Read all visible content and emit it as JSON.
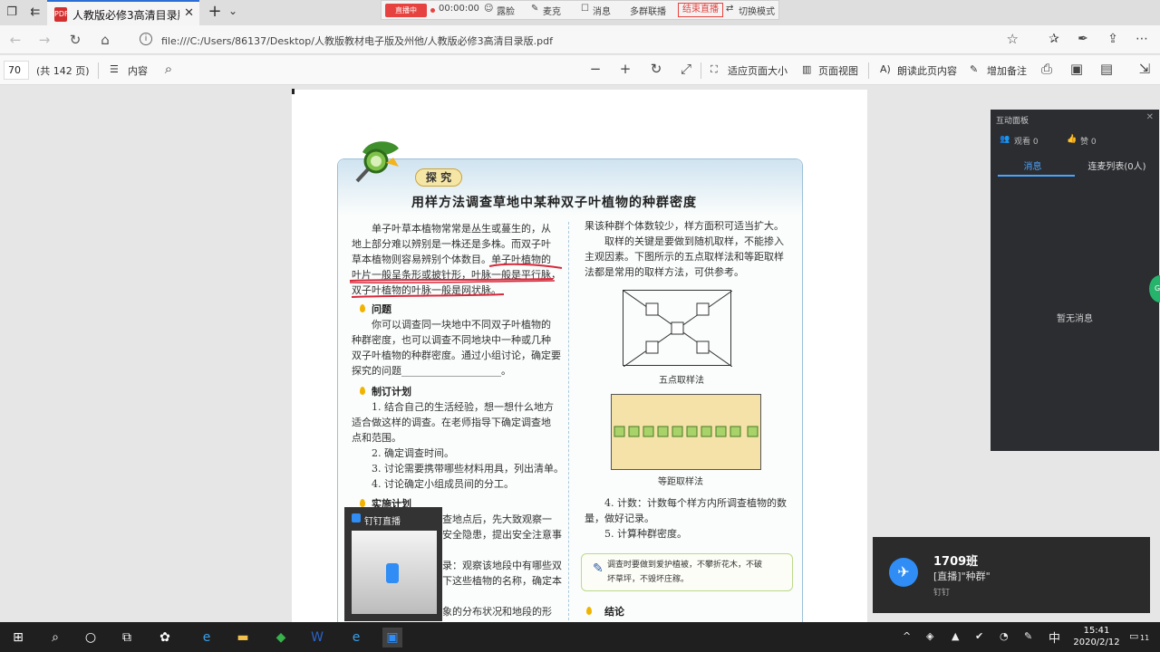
{
  "browser": {
    "tab_title": "人教版必修3高清目录版",
    "url": "file:///C:/Users/86137/Desktop/人教版教材电子版及州他/人教版必修3高清目录版.pdf"
  },
  "live_toolbar": {
    "status": "直播中",
    "timer": "00:00:00",
    "item_hide": "露脸",
    "item_mic": "麦克",
    "item_message": "消息",
    "item_multi": "多群联播",
    "item_end": "结束直播",
    "item_switch": "切换模式"
  },
  "pdf_toolbar": {
    "page_number": "70",
    "page_total": "(共 142 页)",
    "contents": "内容",
    "fit_page": "适应页面大小",
    "page_view": "页面视图",
    "read_aloud": "朗读此页内容",
    "add_notes": "增加备注"
  },
  "page": {
    "tag": "探 究",
    "heading": "用样方法调查草地中某种双子叶植物的种群密度",
    "left_lines": [
      "单子叶草本植物常常是丛生或蔓生的，从",
      "地上部分难以辨别是一株还是多株。而双子叶",
      "草本植物则容易辨别个体数目。单子叶植物的",
      "叶片一般呈条形或披针形，叶脉一般是平行脉，",
      "双子叶植物的叶脉一般是网状脉。"
    ],
    "sec_problem": "问题",
    "problem_lines": [
      "你可以调查同一块地中不同双子叶植物的",
      "种群密度，也可以调查不同地块中一种或几种",
      "双子叶植物的种群密度。通过小组讨论，确定要",
      "探究的问题____________________。"
    ],
    "sec_plan": "制订计划",
    "plan_lines": [
      "1. 结合自己的生活经验，想一想什么地方",
      "适合做这样的调查。在老师指导下确定调查地",
      "点和范围。",
      "2. 确定调查时间。",
      "3. 讨论需要携带哪些材料用具，列出清单。",
      "4. 讨论确定小组成员间的分工。"
    ],
    "sec_implement": "实施计划",
    "implement_lines": [
      "查地点后，先大致观察一",
      "安全隐患，提出安全注意事",
      "",
      "录：观察该地段中有哪些双",
      "下这些植物的名称，确定本",
      "",
      "象的分布状况和地段的形"
    ],
    "right_lines": [
      "果该种群个体数较少，样方面积可适当扩大。",
      "取样的关键是要做到随机取样，不能掺入",
      "主观因素。下图所示的五点取样法和等距取样",
      "法都是常用的取样方法，可供参考。"
    ],
    "fig1_caption": "五点取样法",
    "fig2_caption": "等距取样法",
    "count_lines": [
      "4. 计数：计数每个样方内所调查植物的数",
      "量，做好记录。",
      "5. 计算种群密度。"
    ],
    "note_lines": [
      "调查时要做到爱护植被，不攀折花木，不破",
      "坏草坪，不毁坏庄稼。"
    ],
    "sec_conclusion": "结论"
  },
  "panel": {
    "title": "互动面板",
    "watch": "观看 0",
    "likes": "赞 0",
    "tab_messages": "消息",
    "tab_connect": "连麦列表(0人)",
    "empty": "暂无消息"
  },
  "mini_window": {
    "title": "钉钉直播"
  },
  "toast": {
    "title": "1709班",
    "body": "[直播]\"种群\"",
    "app": "钉钉"
  },
  "taskbar": {
    "ime": "中",
    "time": "15:41",
    "date": "2020/2/12",
    "notif_count": "11"
  },
  "colors": {
    "accent": "#2b6ed6",
    "live_red": "#e64340",
    "dingtalk_blue": "#2f8df5",
    "underline_red": "#d8283a"
  }
}
